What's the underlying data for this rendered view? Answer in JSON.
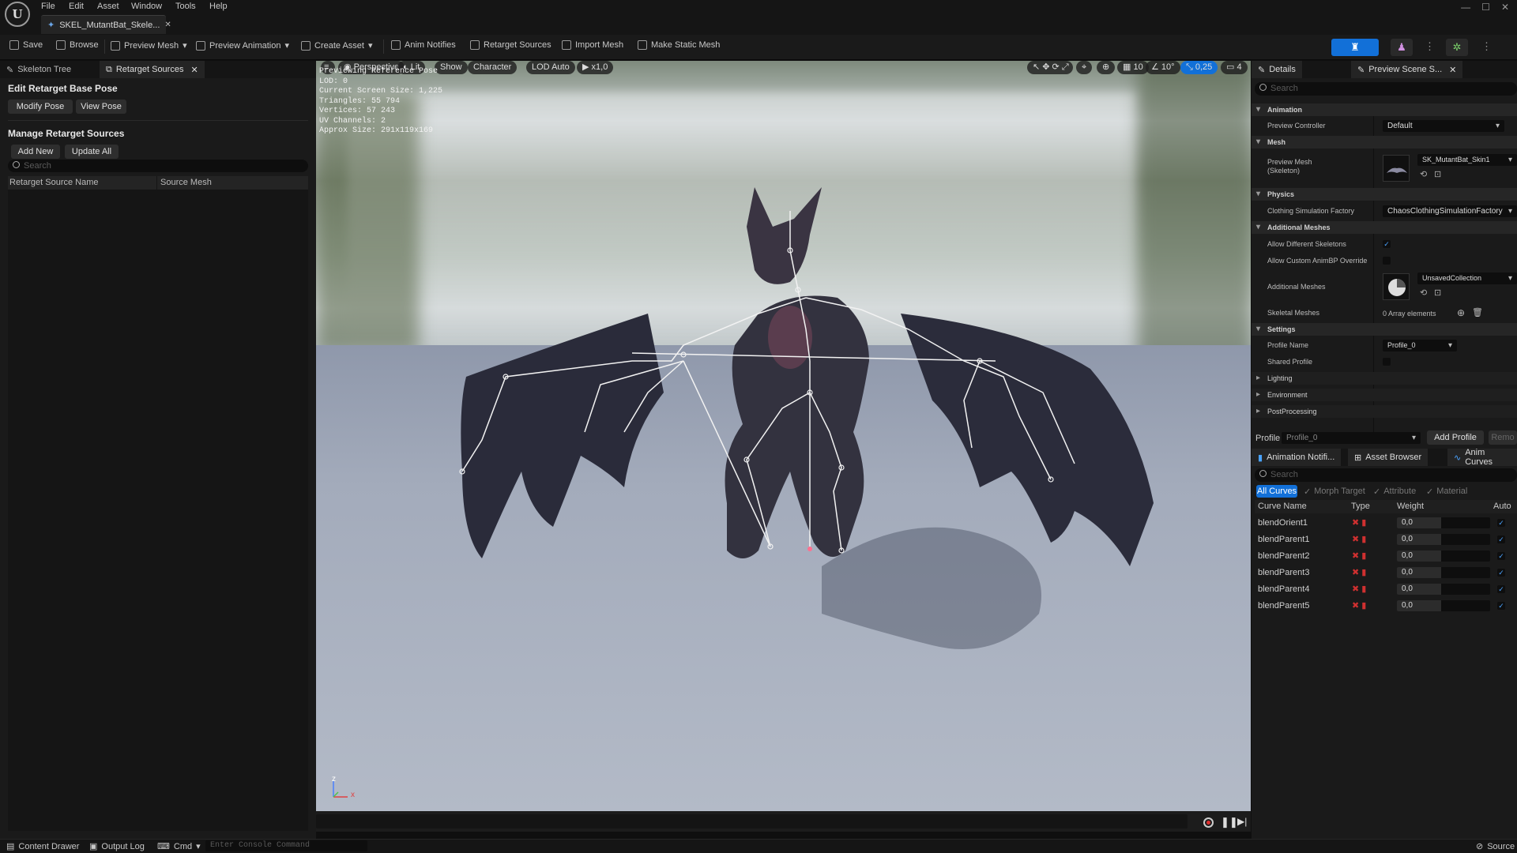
{
  "menu": [
    "File",
    "Edit",
    "Asset",
    "Window",
    "Tools",
    "Help"
  ],
  "document_tab": {
    "label": "SKEL_MutantBat_Skele...",
    "icon": "skeleton-icon"
  },
  "toolbar": {
    "save": "Save",
    "browse": "Browse",
    "preview_mesh": "Preview Mesh",
    "preview_animation": "Preview Animation",
    "create_asset": "Create Asset",
    "anim_notifies": "Anim Notifies",
    "retarget_sources": "Retarget Sources",
    "import_mesh": "Import Mesh",
    "make_static_mesh": "Make Static Mesh"
  },
  "left_panel": {
    "tabs": [
      "Skeleton Tree",
      "Retarget Sources"
    ],
    "edit_title": "Edit Retarget Base Pose",
    "modify_pose": "Modify Pose",
    "view_pose": "View Pose",
    "manage_title": "Manage Retarget Sources",
    "add_new": "Add New",
    "update_all": "Update All",
    "search_placeholder": "Search",
    "columns": [
      "Retarget Source Name",
      "Source Mesh"
    ]
  },
  "viewport": {
    "pills": [
      "Perspective",
      "Lit",
      "Show",
      "Character",
      "LOD Auto",
      "x1,0"
    ],
    "right_pills": [
      "10",
      "10°",
      "0,25",
      "4"
    ],
    "stats": [
      "Previewing Reference Pose",
      "LOD: 0",
      "Current Screen Size: 1,225",
      "Triangles: 55 794",
      "Vertices: 57 243",
      "UV Channels: 2",
      "Approx Size: 291x119x169"
    ],
    "axis_labels": [
      "z",
      "x"
    ]
  },
  "details": {
    "tabs": [
      "Details",
      "Preview Scene S..."
    ],
    "search_placeholder": "Search",
    "categories": {
      "animation": "Animation",
      "mesh": "Mesh",
      "physics": "Physics",
      "additional_meshes": "Additional Meshes",
      "settings": "Settings",
      "lighting": "Lighting",
      "environment": "Environment",
      "postprocessing": "PostProcessing"
    },
    "props": {
      "preview_controller": {
        "label": "Preview Controller",
        "value": "Default"
      },
      "preview_mesh": {
        "label": "Preview Mesh\n(Skeleton)",
        "value": "SK_MutantBat_Skin1"
      },
      "clothing_factory": {
        "label": "Clothing Simulation Factory",
        "value": "ChaosClothingSimulationFactory"
      },
      "allow_diff_skeletons": {
        "label": "Allow Different Skeletons",
        "checked": true
      },
      "allow_custom_animbp": {
        "label": "Allow Custom AnimBP Override",
        "checked": false
      },
      "additional_meshes": {
        "label": "Additional Meshes",
        "value": "UnsavedCollection"
      },
      "skeletal_meshes": {
        "label": "Skeletal Meshes",
        "value": "0 Array elements"
      },
      "profile_name": {
        "label": "Profile Name",
        "value": "Profile_0"
      },
      "shared_profile": {
        "label": "Shared Profile",
        "checked": false
      }
    },
    "profile_bar": {
      "label": "Profile",
      "value": "Profile_0",
      "add": "Add Profile",
      "remove": "Remo"
    }
  },
  "curves_panel": {
    "tabs": [
      "Animation Notifi...",
      "Asset Browser",
      "Anim Curves"
    ],
    "search_placeholder": "Search",
    "filters": [
      "All Curves",
      "Morph Target",
      "Attribute",
      "Material"
    ],
    "columns": [
      "Curve Name",
      "Type",
      "Weight",
      "Auto"
    ],
    "rows": [
      {
        "name": "blendOrient1",
        "weight": "0,0",
        "auto": true
      },
      {
        "name": "blendParent1",
        "weight": "0,0",
        "auto": true
      },
      {
        "name": "blendParent2",
        "weight": "0,0",
        "auto": true
      },
      {
        "name": "blendParent3",
        "weight": "0,0",
        "auto": true
      },
      {
        "name": "blendParent4",
        "weight": "0,0",
        "auto": true
      },
      {
        "name": "blendParent5",
        "weight": "0,0",
        "auto": true
      }
    ]
  },
  "statusbar": {
    "content_drawer": "Content Drawer",
    "output_log": "Output Log",
    "cmd": "Cmd",
    "console_placeholder": "Enter Console Command",
    "source": "Source"
  },
  "colors": {
    "accent": "#1270d8",
    "checkbox": "#4aa3ff",
    "morph_red": "#d03030"
  }
}
